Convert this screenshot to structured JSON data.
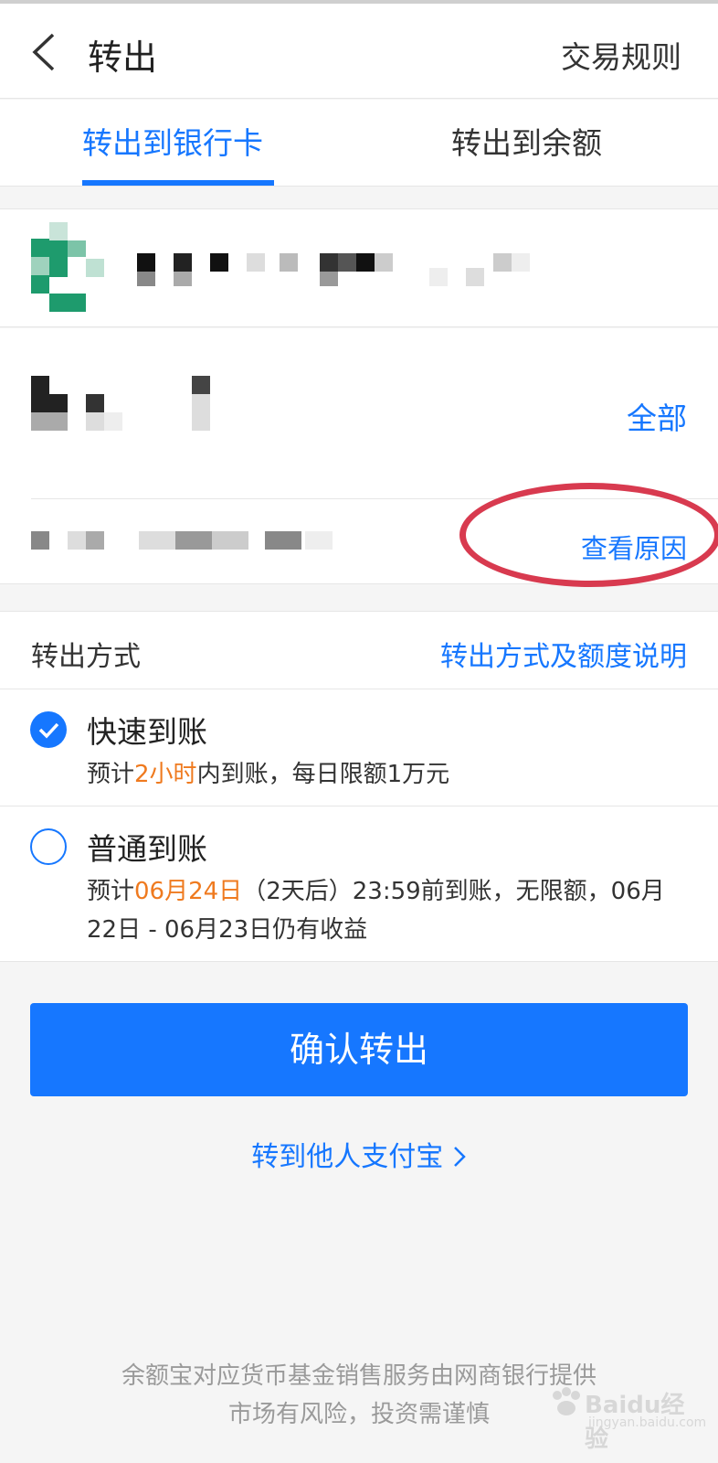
{
  "header": {
    "title": "转出",
    "rules_label": "交易规则"
  },
  "tabs": [
    {
      "label": "转出到银行卡",
      "active": true
    },
    {
      "label": "转出到余额",
      "active": false
    }
  ],
  "amount": {
    "all_label": "全部",
    "reason_label": "查看原因"
  },
  "method": {
    "label": "转出方式",
    "info_label": "转出方式及额度说明"
  },
  "options": [
    {
      "title": "快速到账",
      "desc_prefix": "预计",
      "desc_highlight": "2小时",
      "desc_suffix": "内到账，每日限额1万元",
      "selected": true
    },
    {
      "title": "普通到账",
      "desc_prefix": "预计",
      "desc_highlight": "06月24日",
      "desc_suffix": "（2天后）23:59前到账，无限额，06月22日 - 06月23日仍有收益",
      "selected": false
    }
  ],
  "confirm_label": "确认转出",
  "other_link_label": "转到他人支付宝",
  "footer": {
    "line1": "余额宝对应货币基金销售服务由网商银行提供",
    "line2": "市场有风险，投资需谨慎"
  },
  "watermark": {
    "text": "Baidu经验",
    "url": "jingyan.baidu.com"
  },
  "colors": {
    "accent": "#1677ff",
    "highlight": "#ef7a1f",
    "annotation": "#d83a4f"
  }
}
